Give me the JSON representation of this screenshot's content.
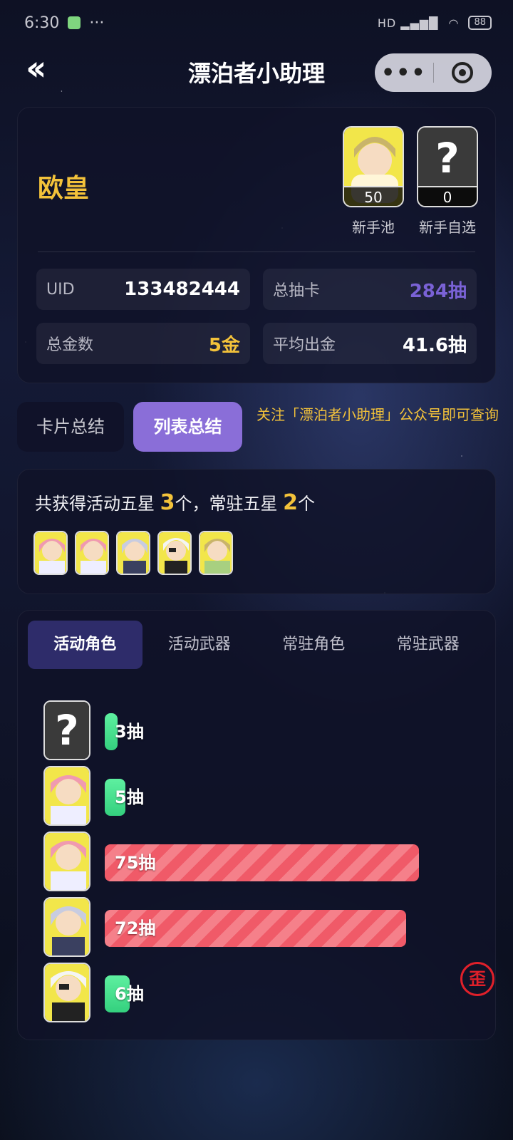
{
  "status": {
    "time": "6:30",
    "dots": "···",
    "battery": "88",
    "network": "HD"
  },
  "nav": {
    "title": "漂泊者小助理",
    "back_icon": "double-chevron-left-icon",
    "more": "•••"
  },
  "summary": {
    "rank": "欧皇",
    "pools": [
      {
        "label": "新手池",
        "count": "50"
      },
      {
        "label": "新手自选",
        "count": "0",
        "unknown": "?"
      }
    ],
    "stats": [
      {
        "key": "UID",
        "value": "133482444",
        "color": "#ffffff"
      },
      {
        "key": "总抽卡",
        "value": "284抽",
        "color": "#7a62d6"
      },
      {
        "key": "总金数",
        "value": "5金",
        "color": "#f3c23a"
      },
      {
        "key": "平均出金",
        "value": "41.6抽",
        "color": "#ffffff"
      }
    ]
  },
  "segments": {
    "card": "卡片总结",
    "list": "列表总结"
  },
  "notice": "关注「漂泊者小助理」公众号即可查询",
  "five_star": {
    "prefix": "共获得活动五星",
    "event_count": "3",
    "mid": "个，常驻五星",
    "standard_count": "2",
    "suffix": "个"
  },
  "tabs": [
    "活动角色",
    "活动武器",
    "常驻角色",
    "常驻武器"
  ],
  "pulls": [
    {
      "pulls": 3,
      "label": "3抽",
      "kind": "green",
      "unknown": "?"
    },
    {
      "pulls": 5,
      "label": "5抽",
      "kind": "green"
    },
    {
      "pulls": 75,
      "label": "75抽",
      "kind": "red"
    },
    {
      "pulls": 72,
      "label": "72抽",
      "kind": "red"
    },
    {
      "pulls": 6,
      "label": "6抽",
      "kind": "green"
    }
  ],
  "wai_badge": "歪",
  "colors": {
    "accent": "#8a6ed8",
    "gold": "#f3c23a",
    "bad": "#f05a68",
    "good": "#34d07e"
  }
}
